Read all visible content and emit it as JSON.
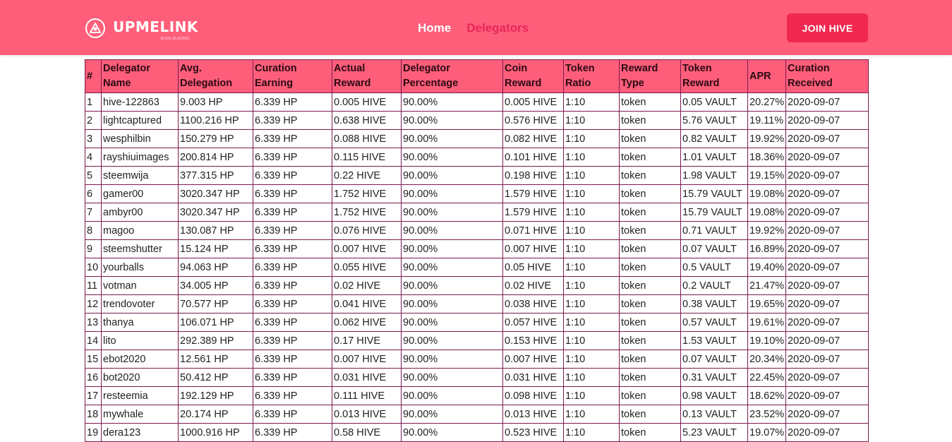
{
  "brand": {
    "name": "UPMELINK",
    "tagline": "BLOG BLAZING"
  },
  "nav": {
    "home": "Home",
    "delegators": "Delegators",
    "join": "JOIN HIVE"
  },
  "colors": {
    "navbar": "#ff5e7a",
    "active_link": "#e8265a",
    "button": "#f0284f",
    "table_border": "#7a1a4e"
  },
  "table": {
    "headers": [
      "#",
      "Delegator Name",
      "Avg. Delegation",
      "Curation Earning",
      "Actual Reward",
      "Delegator Percentage",
      "Coin Reward",
      "Token Ratio",
      "Reward Type",
      "Token Reward",
      "APR",
      "Curation Received"
    ],
    "rows": [
      [
        "1",
        "hive-122863",
        "9.003 HP",
        "6.339 HP",
        "0.005 HIVE",
        "90.00%",
        "0.005 HIVE",
        "1:10",
        "token",
        "0.05 VAULT",
        "20.27%",
        "2020-09-07"
      ],
      [
        "2",
        "lightcaptured",
        "1100.216 HP",
        "6.339 HP",
        "0.638 HIVE",
        "90.00%",
        "0.576 HIVE",
        "1:10",
        "token",
        "5.76 VAULT",
        "19.11%",
        "2020-09-07"
      ],
      [
        "3",
        "wesphilbin",
        "150.279 HP",
        "6.339 HP",
        "0.088 HIVE",
        "90.00%",
        "0.082 HIVE",
        "1:10",
        "token",
        "0.82 VAULT",
        "19.92%",
        "2020-09-07"
      ],
      [
        "4",
        "rayshiuimages",
        "200.814 HP",
        "6.339 HP",
        "0.115 HIVE",
        "90.00%",
        "0.101 HIVE",
        "1:10",
        "token",
        "1.01 VAULT",
        "18.36%",
        "2020-09-07"
      ],
      [
        "5",
        "steemwija",
        "377.315 HP",
        "6.339 HP",
        "0.22 HIVE",
        "90.00%",
        "0.198 HIVE",
        "1:10",
        "token",
        "1.98 VAULT",
        "19.15%",
        "2020-09-07"
      ],
      [
        "6",
        "gamer00",
        "3020.347 HP",
        "6.339 HP",
        "1.752 HIVE",
        "90.00%",
        "1.579 HIVE",
        "1:10",
        "token",
        "15.79 VAULT",
        "19.08%",
        "2020-09-07"
      ],
      [
        "7",
        "ambyr00",
        "3020.347 HP",
        "6.339 HP",
        "1.752 HIVE",
        "90.00%",
        "1.579 HIVE",
        "1:10",
        "token",
        "15.79 VAULT",
        "19.08%",
        "2020-09-07"
      ],
      [
        "8",
        "magoo",
        "130.087 HP",
        "6.339 HP",
        "0.076 HIVE",
        "90.00%",
        "0.071 HIVE",
        "1:10",
        "token",
        "0.71 VAULT",
        "19.92%",
        "2020-09-07"
      ],
      [
        "9",
        "steemshutter",
        "15.124 HP",
        "6.339 HP",
        "0.007 HIVE",
        "90.00%",
        "0.007 HIVE",
        "1:10",
        "token",
        "0.07 VAULT",
        "16.89%",
        "2020-09-07"
      ],
      [
        "10",
        "yourballs",
        "94.063 HP",
        "6.339 HP",
        "0.055 HIVE",
        "90.00%",
        "0.05 HIVE",
        "1:10",
        "token",
        "0.5 VAULT",
        "19.40%",
        "2020-09-07"
      ],
      [
        "11",
        "votman",
        "34.005 HP",
        "6.339 HP",
        "0.02 HIVE",
        "90.00%",
        "0.02 HIVE",
        "1:10",
        "token",
        "0.2 VAULT",
        "21.47%",
        "2020-09-07"
      ],
      [
        "12",
        "trendovoter",
        "70.577 HP",
        "6.339 HP",
        "0.041 HIVE",
        "90.00%",
        "0.038 HIVE",
        "1:10",
        "token",
        "0.38 VAULT",
        "19.65%",
        "2020-09-07"
      ],
      [
        "13",
        "thanya",
        "106.071 HP",
        "6.339 HP",
        "0.062 HIVE",
        "90.00%",
        "0.057 HIVE",
        "1:10",
        "token",
        "0.57 VAULT",
        "19.61%",
        "2020-09-07"
      ],
      [
        "14",
        "lito",
        "292.389 HP",
        "6.339 HP",
        "0.17 HIVE",
        "90.00%",
        "0.153 HIVE",
        "1:10",
        "token",
        "1.53 VAULT",
        "19.10%",
        "2020-09-07"
      ],
      [
        "15",
        "ebot2020",
        "12.561 HP",
        "6.339 HP",
        "0.007 HIVE",
        "90.00%",
        "0.007 HIVE",
        "1:10",
        "token",
        "0.07 VAULT",
        "20.34%",
        "2020-09-07"
      ],
      [
        "16",
        "bot2020",
        "50.412 HP",
        "6.339 HP",
        "0.031 HIVE",
        "90.00%",
        "0.031 HIVE",
        "1:10",
        "token",
        "0.31 VAULT",
        "22.45%",
        "2020-09-07"
      ],
      [
        "17",
        "resteemia",
        "192.129 HP",
        "6.339 HP",
        "0.111 HIVE",
        "90.00%",
        "0.098 HIVE",
        "1:10",
        "token",
        "0.98 VAULT",
        "18.62%",
        "2020-09-07"
      ],
      [
        "18",
        "mywhale",
        "20.174 HP",
        "6.339 HP",
        "0.013 HIVE",
        "90.00%",
        "0.013 HIVE",
        "1:10",
        "token",
        "0.13 VAULT",
        "23.52%",
        "2020-09-07"
      ],
      [
        "19",
        "dera123",
        "1000.916 HP",
        "6.339 HP",
        "0.58 HIVE",
        "90.00%",
        "0.523 HIVE",
        "1:10",
        "token",
        "5.23 VAULT",
        "19.07%",
        "2020-09-07"
      ]
    ]
  }
}
